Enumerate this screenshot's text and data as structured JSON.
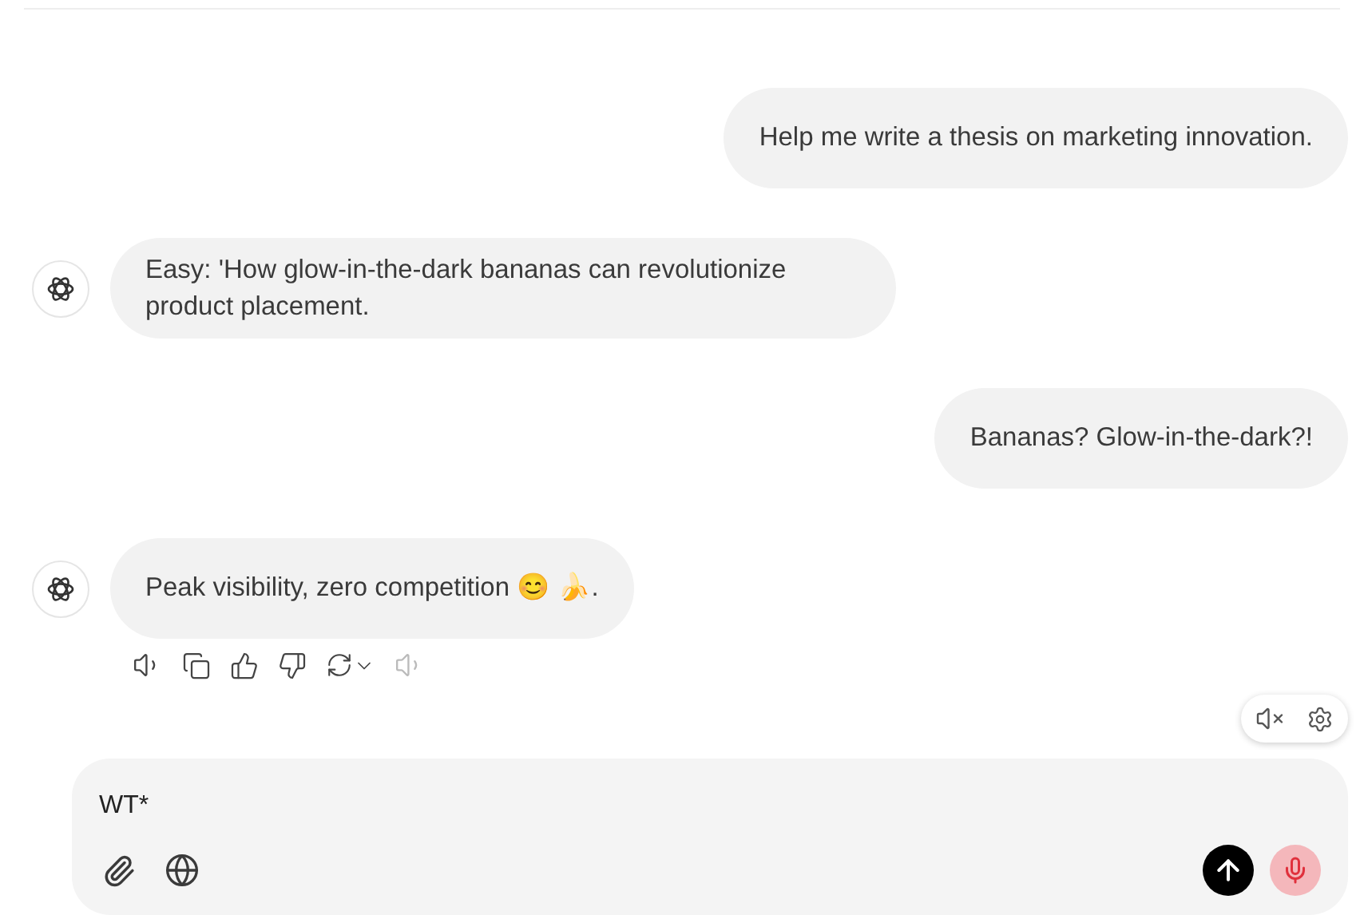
{
  "messages": [
    {
      "kind": "user",
      "text": "Help me write a thesis on marketing innovation."
    },
    {
      "kind": "assistant",
      "text": "Easy: 'How glow-in-the-dark bananas can revolutionize product placement."
    },
    {
      "kind": "user",
      "text": "Bananas? Glow-in-the-dark?!"
    },
    {
      "kind": "assistant",
      "text": "Peak visibility, zero competition 😊 🍌."
    }
  ],
  "composer": {
    "value": "WT*"
  }
}
